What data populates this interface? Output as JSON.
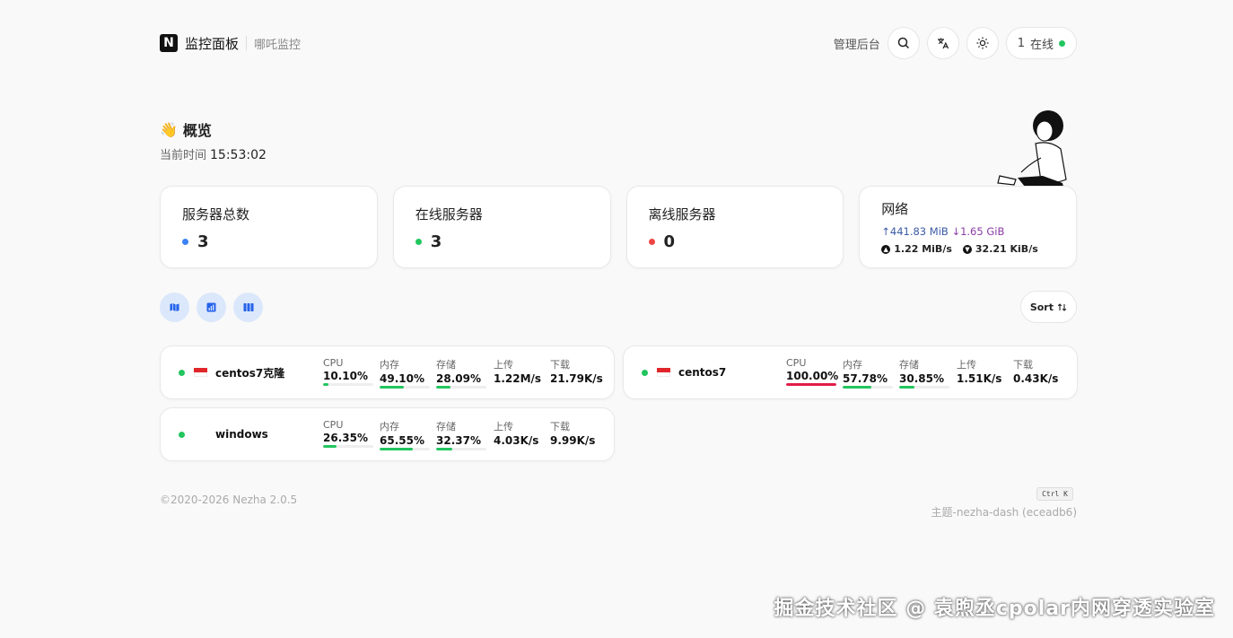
{
  "header": {
    "logo_letter": "N",
    "title": "监控面板",
    "subtitle": "哪吒监控",
    "admin_label": "管理后台",
    "online_count": "1",
    "online_label": "在线"
  },
  "overview": {
    "emoji": "👋",
    "title": "概览",
    "time_label": "当前时间",
    "time_value": "15:53:02"
  },
  "stats": {
    "total": {
      "label": "服务器总数",
      "value": "3",
      "color": "#3b82f6"
    },
    "online": {
      "label": "在线服务器",
      "value": "3",
      "color": "#22c55e"
    },
    "offline": {
      "label": "离线服务器",
      "value": "0",
      "color": "#ef4444"
    },
    "network": {
      "label": "网络",
      "up_total": "↑441.83 MiB",
      "down_total": "↓1.65 GiB",
      "up_speed": "1.22 MiB/s",
      "down_speed": "32.21 KiB/s"
    }
  },
  "toolbar": {
    "views": [
      "map-icon",
      "chart-icon",
      "grid-icon"
    ],
    "sort_label": "Sort"
  },
  "metric_labels": {
    "cpu": "CPU",
    "mem": "内存",
    "disk": "存储",
    "up": "上传",
    "down": "下载"
  },
  "servers": [
    {
      "name": "centos7克隆",
      "flag": "SG",
      "cpu": "10.10%",
      "cpu_pct": 10.1,
      "mem": "49.10%",
      "mem_pct": 49.1,
      "disk": "28.09%",
      "disk_pct": 28.09,
      "up": "1.22M/s",
      "down": "21.79K/s"
    },
    {
      "name": "centos7",
      "flag": "SG",
      "cpu": "100.00%",
      "cpu_pct": 100,
      "mem": "57.78%",
      "mem_pct": 57.78,
      "disk": "30.85%",
      "disk_pct": 30.85,
      "up": "1.51K/s",
      "down": "0.43K/s"
    },
    {
      "name": "windows",
      "flag": "",
      "cpu": "26.35%",
      "cpu_pct": 26.35,
      "mem": "65.55%",
      "mem_pct": 65.55,
      "disk": "32.37%",
      "disk_pct": 32.37,
      "up": "4.03K/s",
      "down": "9.99K/s"
    }
  ],
  "footer": {
    "copyright": "©2020-2026 Nezha 2.0.5",
    "shortcut": "Ctrl K",
    "theme": "主题-nezha-dash (eceadb6)"
  },
  "watermark": "掘金技术社区 @ 袁煦丞cpolar内网穿透实验室",
  "colors": {
    "ok": "#22c55e",
    "danger": "#e11d48",
    "accent_bg": "#dbe7fb",
    "accent": "#2563eb"
  }
}
